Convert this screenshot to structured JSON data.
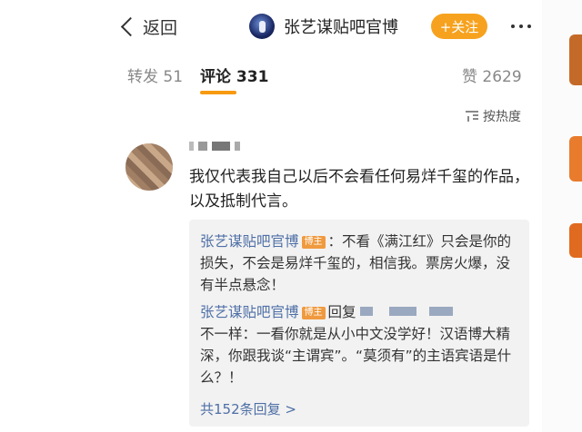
{
  "header": {
    "back_label": "返回",
    "title": "张艺谋贴吧官博",
    "follow_label": "+关注",
    "follow_color": "#f7a21e"
  },
  "tabs": [
    {
      "label": "转发 51",
      "active": false
    },
    {
      "label": "评论 331",
      "active": true
    },
    {
      "label": "赞 2629",
      "active": false
    }
  ],
  "sort_label": "按热度",
  "comment": {
    "text": "我仅代表我自己以后不会看任何易烊千玺的作品，以及抵制代言。"
  },
  "replies": [
    {
      "user": "张艺谋贴吧官博",
      "tag": "博主",
      "text": "：不看《满江红》只会是你的损失，不会是易烊千玺的，相信我。票房火爆，没有半点悬念！"
    },
    {
      "user": "张艺谋贴吧官博",
      "tag": "博主",
      "action": "回复",
      "text": "不一样：一看你就是从小中文没学好！汉语博大精深，你跟我谈“主谓宾”。“莫须有”的主语宾语是什么？！"
    }
  ],
  "more_replies_label": "共152条回复 >",
  "colors": {
    "accent": "#f79a10",
    "link": "#4e6fa6"
  }
}
